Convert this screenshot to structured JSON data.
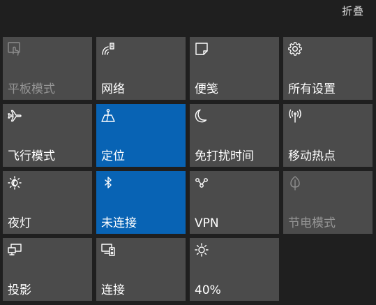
{
  "header": {
    "collapse_label": "折叠"
  },
  "colors": {
    "background": "#1f1f1f",
    "tile": "#4b4b4b",
    "tile_active": "#0863b4",
    "text": "#ffffff",
    "text_disabled": "#959595"
  },
  "tiles": [
    {
      "label": "平板模式",
      "icon": "tablet-mode-icon",
      "state": "disabled"
    },
    {
      "label": "网络",
      "icon": "network-icon",
      "state": "normal"
    },
    {
      "label": "便笺",
      "icon": "note-icon",
      "state": "normal"
    },
    {
      "label": "所有设置",
      "icon": "gear-icon",
      "state": "normal"
    },
    {
      "label": "飞行模式",
      "icon": "airplane-icon",
      "state": "normal"
    },
    {
      "label": "定位",
      "icon": "location-icon",
      "state": "active"
    },
    {
      "label": "免打扰时间",
      "icon": "moon-icon",
      "state": "normal"
    },
    {
      "label": "移动热点",
      "icon": "hotspot-icon",
      "state": "normal"
    },
    {
      "label": "夜灯",
      "icon": "night-light-icon",
      "state": "normal"
    },
    {
      "label": "未连接",
      "icon": "bluetooth-icon",
      "state": "active"
    },
    {
      "label": "VPN",
      "icon": "vpn-icon",
      "state": "normal"
    },
    {
      "label": "节电模式",
      "icon": "battery-saver-icon",
      "state": "disabled"
    },
    {
      "label": "投影",
      "icon": "project-icon",
      "state": "normal"
    },
    {
      "label": "连接",
      "icon": "connect-icon",
      "state": "normal"
    },
    {
      "label": "40%",
      "icon": "brightness-icon",
      "state": "normal"
    }
  ]
}
